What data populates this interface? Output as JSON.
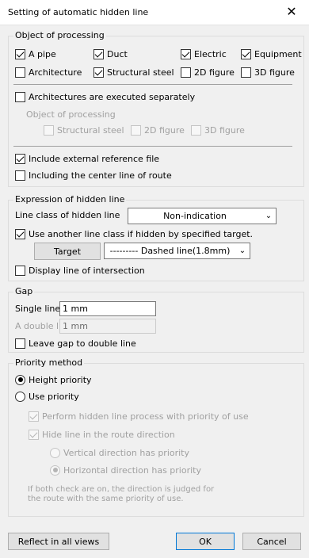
{
  "window": {
    "title": "Setting of automatic hidden line",
    "close_glyph": "✕"
  },
  "object_of_processing": {
    "legend": "Object of processing",
    "items": [
      {
        "label": "A pipe",
        "checked": true
      },
      {
        "label": "Duct",
        "checked": true
      },
      {
        "label": "Electric",
        "checked": true
      },
      {
        "label": "Equipment",
        "checked": true
      },
      {
        "label": "Architecture",
        "checked": false
      },
      {
        "label": "Structural steel",
        "checked": true
      },
      {
        "label": "2D figure",
        "checked": false
      },
      {
        "label": "3D figure",
        "checked": false
      }
    ],
    "arch_separately": {
      "label": "Architectures are executed separately",
      "checked": false
    },
    "sub_legend": "Object of processing",
    "sub_items": [
      {
        "label": "Structural steel",
        "checked": false
      },
      {
        "label": "2D figure",
        "checked": false
      },
      {
        "label": "3D figure",
        "checked": false
      }
    ],
    "include_external": {
      "label": "Include external reference file",
      "checked": true
    },
    "include_center": {
      "label": "Including the center line of route",
      "checked": false
    }
  },
  "expression": {
    "legend": "Expression of hidden line",
    "line_class_label": "Line class of hidden line",
    "line_class_value": "Non-indication",
    "use_another": {
      "label": "Use another line class if hidden by specified target.",
      "checked": true
    },
    "target_button": "Target",
    "dashed_value": "--------- Dashed line(1.8mm)",
    "display_intersection": {
      "label": "Display line of intersection",
      "checked": false
    }
  },
  "gap": {
    "legend": "Gap",
    "single_label": "Single line",
    "single_value": "1 mm",
    "double_label": "A double line",
    "double_value": "1 mm",
    "leave_gap": {
      "label": "Leave gap to double line",
      "checked": false
    }
  },
  "priority": {
    "legend": "Priority method",
    "height_priority": {
      "label": "Height priority",
      "selected": true
    },
    "use_priority": {
      "label": "Use priority",
      "selected": false
    },
    "perform_hidden": {
      "label": "Perform hidden line process with priority of use",
      "checked": true
    },
    "hide_route": {
      "label": "Hide line in the route direction",
      "checked": true
    },
    "vertical": {
      "label": "Vertical direction has priority",
      "selected": false
    },
    "horizontal": {
      "label": "Horizontal direction has priority",
      "selected": true
    },
    "note_line1": "If both check are on, the direction is judged for",
    "note_line2": "the route with the same priority of use."
  },
  "footer": {
    "reflect": "Reflect in all views",
    "ok": "OK",
    "cancel": "Cancel"
  }
}
